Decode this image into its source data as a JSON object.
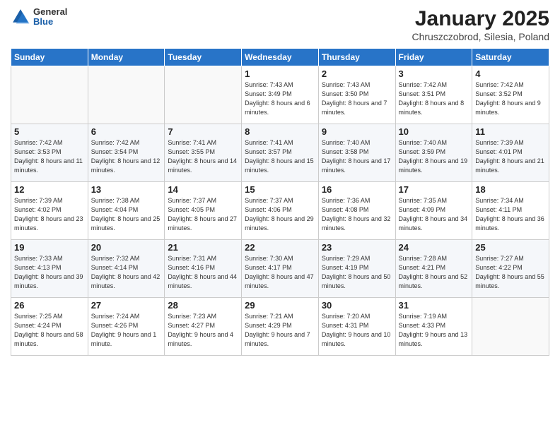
{
  "logo": {
    "general": "General",
    "blue": "Blue"
  },
  "header": {
    "title": "January 2025",
    "subtitle": "Chruszczobrod, Silesia, Poland"
  },
  "weekdays": [
    "Sunday",
    "Monday",
    "Tuesday",
    "Wednesday",
    "Thursday",
    "Friday",
    "Saturday"
  ],
  "weeks": [
    [
      {
        "day": "",
        "info": ""
      },
      {
        "day": "",
        "info": ""
      },
      {
        "day": "",
        "info": ""
      },
      {
        "day": "1",
        "info": "Sunrise: 7:43 AM\nSunset: 3:49 PM\nDaylight: 8 hours and 6 minutes."
      },
      {
        "day": "2",
        "info": "Sunrise: 7:43 AM\nSunset: 3:50 PM\nDaylight: 8 hours and 7 minutes."
      },
      {
        "day": "3",
        "info": "Sunrise: 7:42 AM\nSunset: 3:51 PM\nDaylight: 8 hours and 8 minutes."
      },
      {
        "day": "4",
        "info": "Sunrise: 7:42 AM\nSunset: 3:52 PM\nDaylight: 8 hours and 9 minutes."
      }
    ],
    [
      {
        "day": "5",
        "info": "Sunrise: 7:42 AM\nSunset: 3:53 PM\nDaylight: 8 hours and 11 minutes."
      },
      {
        "day": "6",
        "info": "Sunrise: 7:42 AM\nSunset: 3:54 PM\nDaylight: 8 hours and 12 minutes."
      },
      {
        "day": "7",
        "info": "Sunrise: 7:41 AM\nSunset: 3:55 PM\nDaylight: 8 hours and 14 minutes."
      },
      {
        "day": "8",
        "info": "Sunrise: 7:41 AM\nSunset: 3:57 PM\nDaylight: 8 hours and 15 minutes."
      },
      {
        "day": "9",
        "info": "Sunrise: 7:40 AM\nSunset: 3:58 PM\nDaylight: 8 hours and 17 minutes."
      },
      {
        "day": "10",
        "info": "Sunrise: 7:40 AM\nSunset: 3:59 PM\nDaylight: 8 hours and 19 minutes."
      },
      {
        "day": "11",
        "info": "Sunrise: 7:39 AM\nSunset: 4:01 PM\nDaylight: 8 hours and 21 minutes."
      }
    ],
    [
      {
        "day": "12",
        "info": "Sunrise: 7:39 AM\nSunset: 4:02 PM\nDaylight: 8 hours and 23 minutes."
      },
      {
        "day": "13",
        "info": "Sunrise: 7:38 AM\nSunset: 4:04 PM\nDaylight: 8 hours and 25 minutes."
      },
      {
        "day": "14",
        "info": "Sunrise: 7:37 AM\nSunset: 4:05 PM\nDaylight: 8 hours and 27 minutes."
      },
      {
        "day": "15",
        "info": "Sunrise: 7:37 AM\nSunset: 4:06 PM\nDaylight: 8 hours and 29 minutes."
      },
      {
        "day": "16",
        "info": "Sunrise: 7:36 AM\nSunset: 4:08 PM\nDaylight: 8 hours and 32 minutes."
      },
      {
        "day": "17",
        "info": "Sunrise: 7:35 AM\nSunset: 4:09 PM\nDaylight: 8 hours and 34 minutes."
      },
      {
        "day": "18",
        "info": "Sunrise: 7:34 AM\nSunset: 4:11 PM\nDaylight: 8 hours and 36 minutes."
      }
    ],
    [
      {
        "day": "19",
        "info": "Sunrise: 7:33 AM\nSunset: 4:13 PM\nDaylight: 8 hours and 39 minutes."
      },
      {
        "day": "20",
        "info": "Sunrise: 7:32 AM\nSunset: 4:14 PM\nDaylight: 8 hours and 42 minutes."
      },
      {
        "day": "21",
        "info": "Sunrise: 7:31 AM\nSunset: 4:16 PM\nDaylight: 8 hours and 44 minutes."
      },
      {
        "day": "22",
        "info": "Sunrise: 7:30 AM\nSunset: 4:17 PM\nDaylight: 8 hours and 47 minutes."
      },
      {
        "day": "23",
        "info": "Sunrise: 7:29 AM\nSunset: 4:19 PM\nDaylight: 8 hours and 50 minutes."
      },
      {
        "day": "24",
        "info": "Sunrise: 7:28 AM\nSunset: 4:21 PM\nDaylight: 8 hours and 52 minutes."
      },
      {
        "day": "25",
        "info": "Sunrise: 7:27 AM\nSunset: 4:22 PM\nDaylight: 8 hours and 55 minutes."
      }
    ],
    [
      {
        "day": "26",
        "info": "Sunrise: 7:25 AM\nSunset: 4:24 PM\nDaylight: 8 hours and 58 minutes."
      },
      {
        "day": "27",
        "info": "Sunrise: 7:24 AM\nSunset: 4:26 PM\nDaylight: 9 hours and 1 minute."
      },
      {
        "day": "28",
        "info": "Sunrise: 7:23 AM\nSunset: 4:27 PM\nDaylight: 9 hours and 4 minutes."
      },
      {
        "day": "29",
        "info": "Sunrise: 7:21 AM\nSunset: 4:29 PM\nDaylight: 9 hours and 7 minutes."
      },
      {
        "day": "30",
        "info": "Sunrise: 7:20 AM\nSunset: 4:31 PM\nDaylight: 9 hours and 10 minutes."
      },
      {
        "day": "31",
        "info": "Sunrise: 7:19 AM\nSunset: 4:33 PM\nDaylight: 9 hours and 13 minutes."
      },
      {
        "day": "",
        "info": ""
      }
    ]
  ]
}
